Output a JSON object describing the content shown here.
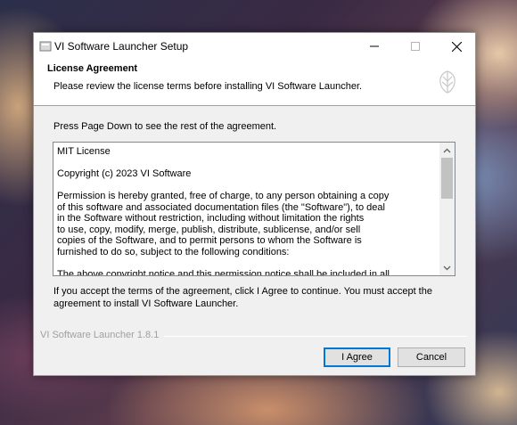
{
  "window": {
    "title": "VI Software Launcher Setup"
  },
  "header": {
    "title": "License Agreement",
    "subtitle": "Please review the license terms before installing VI Software Launcher."
  },
  "main": {
    "instruction": "Press Page Down to see the rest of the agreement.",
    "license_text": "MIT License\n\nCopyright (c) 2023 VI Software\n\nPermission is hereby granted, free of charge, to any person obtaining a copy\nof this software and associated documentation files (the \"Software\"), to deal\nin the Software without restriction, including without limitation the rights\nto use, copy, modify, merge, publish, distribute, sublicense, and/or sell\ncopies of the Software, and to permit persons to whom the Software is\nfurnished to do so, subject to the following conditions:\n\nThe above copyright notice and this permission notice shall be included in all",
    "accept_text": "If you accept the terms of the agreement, click I Agree to continue. You must accept the agreement to install VI Software Launcher."
  },
  "footer": {
    "version": "VI Software Launcher 1.8.1",
    "agree_label": "I Agree",
    "cancel_label": "Cancel"
  },
  "colors": {
    "focus_border": "#0078d7",
    "dialog_bg": "#f0f0f0"
  }
}
